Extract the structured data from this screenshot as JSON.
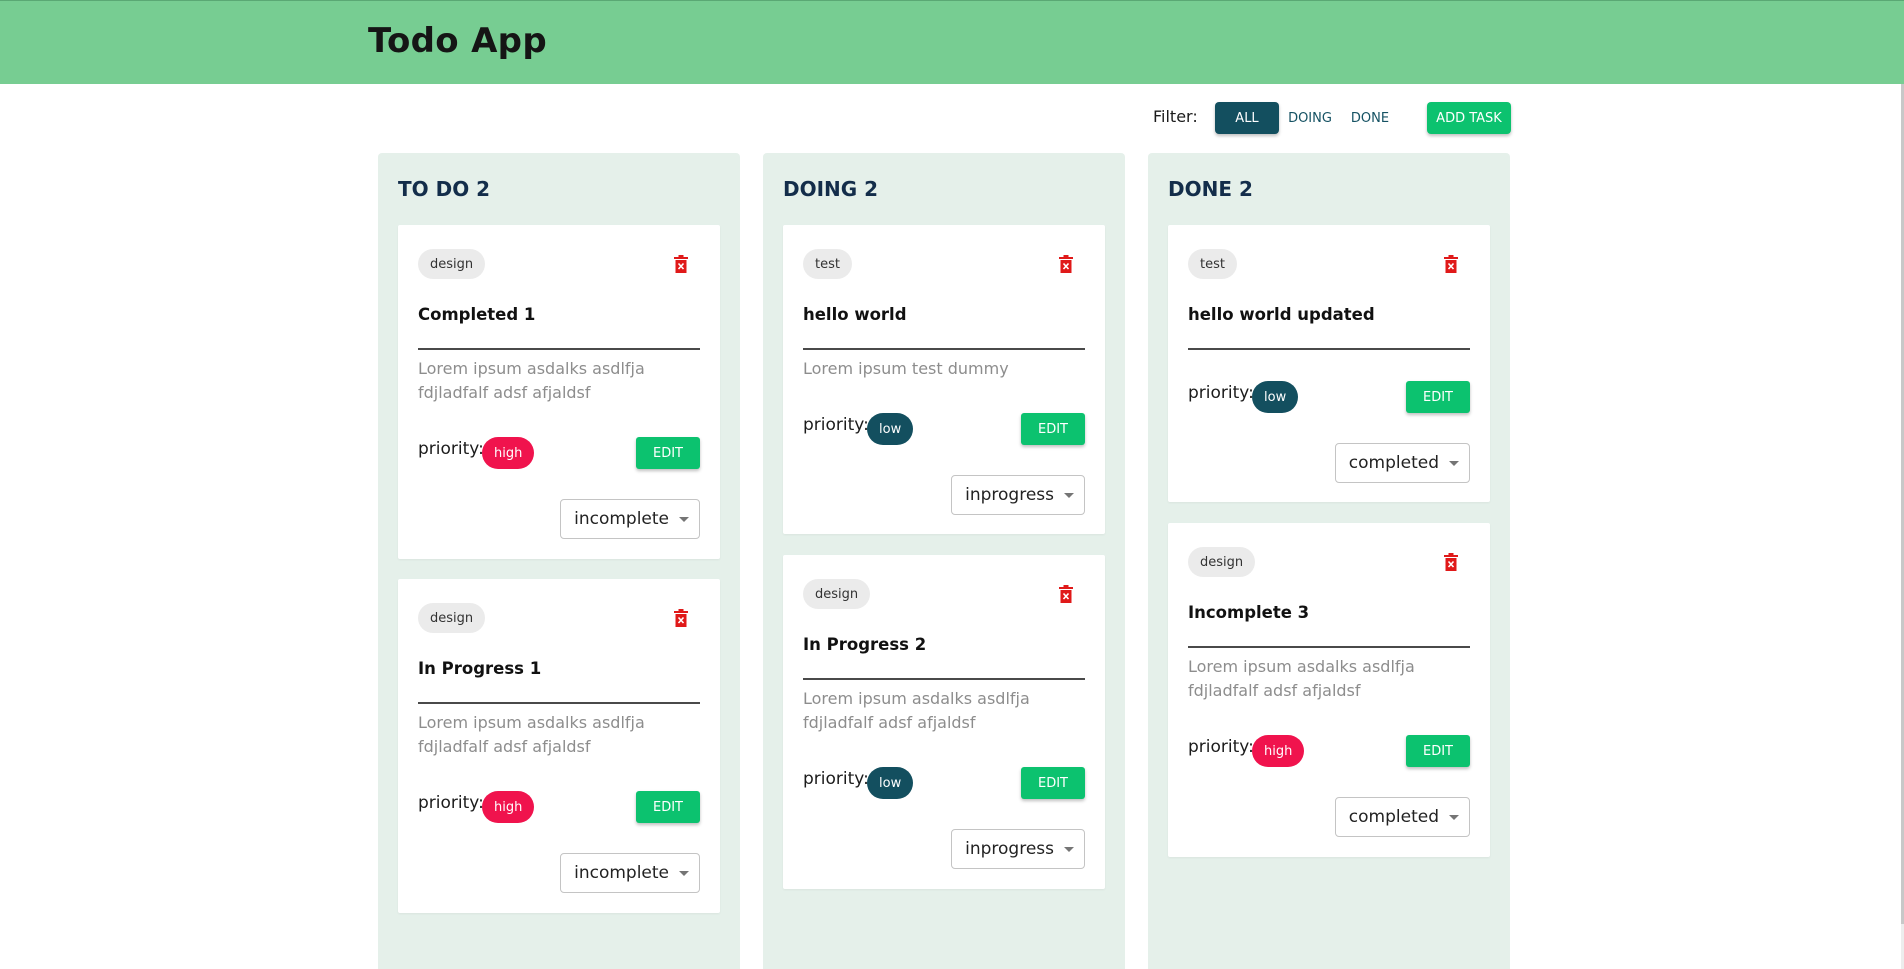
{
  "app": {
    "title": "Todo App"
  },
  "toolbar": {
    "filter_label": "Filter:",
    "filters": [
      "ALL",
      "DOING",
      "DONE"
    ],
    "active_filter": "ALL",
    "add_task_label": "ADD TASK"
  },
  "colors": {
    "header": "#77cd92",
    "accent_green": "#0cc26f",
    "active_filter": "#134f5f",
    "priority_high": "#f0134d",
    "priority_low": "#134f5f",
    "column_bg": "#e5f0ea"
  },
  "columns": [
    {
      "title": "TO DO 2",
      "cards": [
        {
          "tag": "design",
          "title": "Completed 1",
          "description": "Lorem ipsum asdalks asdlfja fdjladfalf adsf afjaldsf",
          "priority_label": "priority:",
          "priority": "high",
          "edit_label": "EDIT",
          "status": "incomplete"
        },
        {
          "tag": "design",
          "title": "In Progress 1",
          "description": "Lorem ipsum asdalks asdlfja fdjladfalf adsf afjaldsf",
          "priority_label": "priority:",
          "priority": "high",
          "edit_label": "EDIT",
          "status": "incomplete"
        }
      ]
    },
    {
      "title": "DOING 2",
      "cards": [
        {
          "tag": "test",
          "title": "hello world",
          "description": "Lorem ipsum test dummy",
          "priority_label": "priority:",
          "priority": "low",
          "edit_label": "EDIT",
          "status": "inprogress"
        },
        {
          "tag": "design",
          "title": "In Progress 2",
          "description": "Lorem ipsum asdalks asdlfja fdjladfalf adsf afjaldsf",
          "priority_label": "priority:",
          "priority": "low",
          "edit_label": "EDIT",
          "status": "inprogress"
        }
      ]
    },
    {
      "title": "DONE 2",
      "cards": [
        {
          "tag": "test",
          "title": "hello world updated",
          "description": "",
          "priority_label": "priority:",
          "priority": "low",
          "edit_label": "EDIT",
          "status": "completed"
        },
        {
          "tag": "design",
          "title": "Incomplete 3",
          "description": "Lorem ipsum asdalks asdlfja fdjladfalf adsf afjaldsf",
          "priority_label": "priority:",
          "priority": "high",
          "edit_label": "EDIT",
          "status": "completed"
        }
      ]
    }
  ],
  "icons": {
    "delete": "trash-icon",
    "dropdown": "caret-down-icon"
  }
}
